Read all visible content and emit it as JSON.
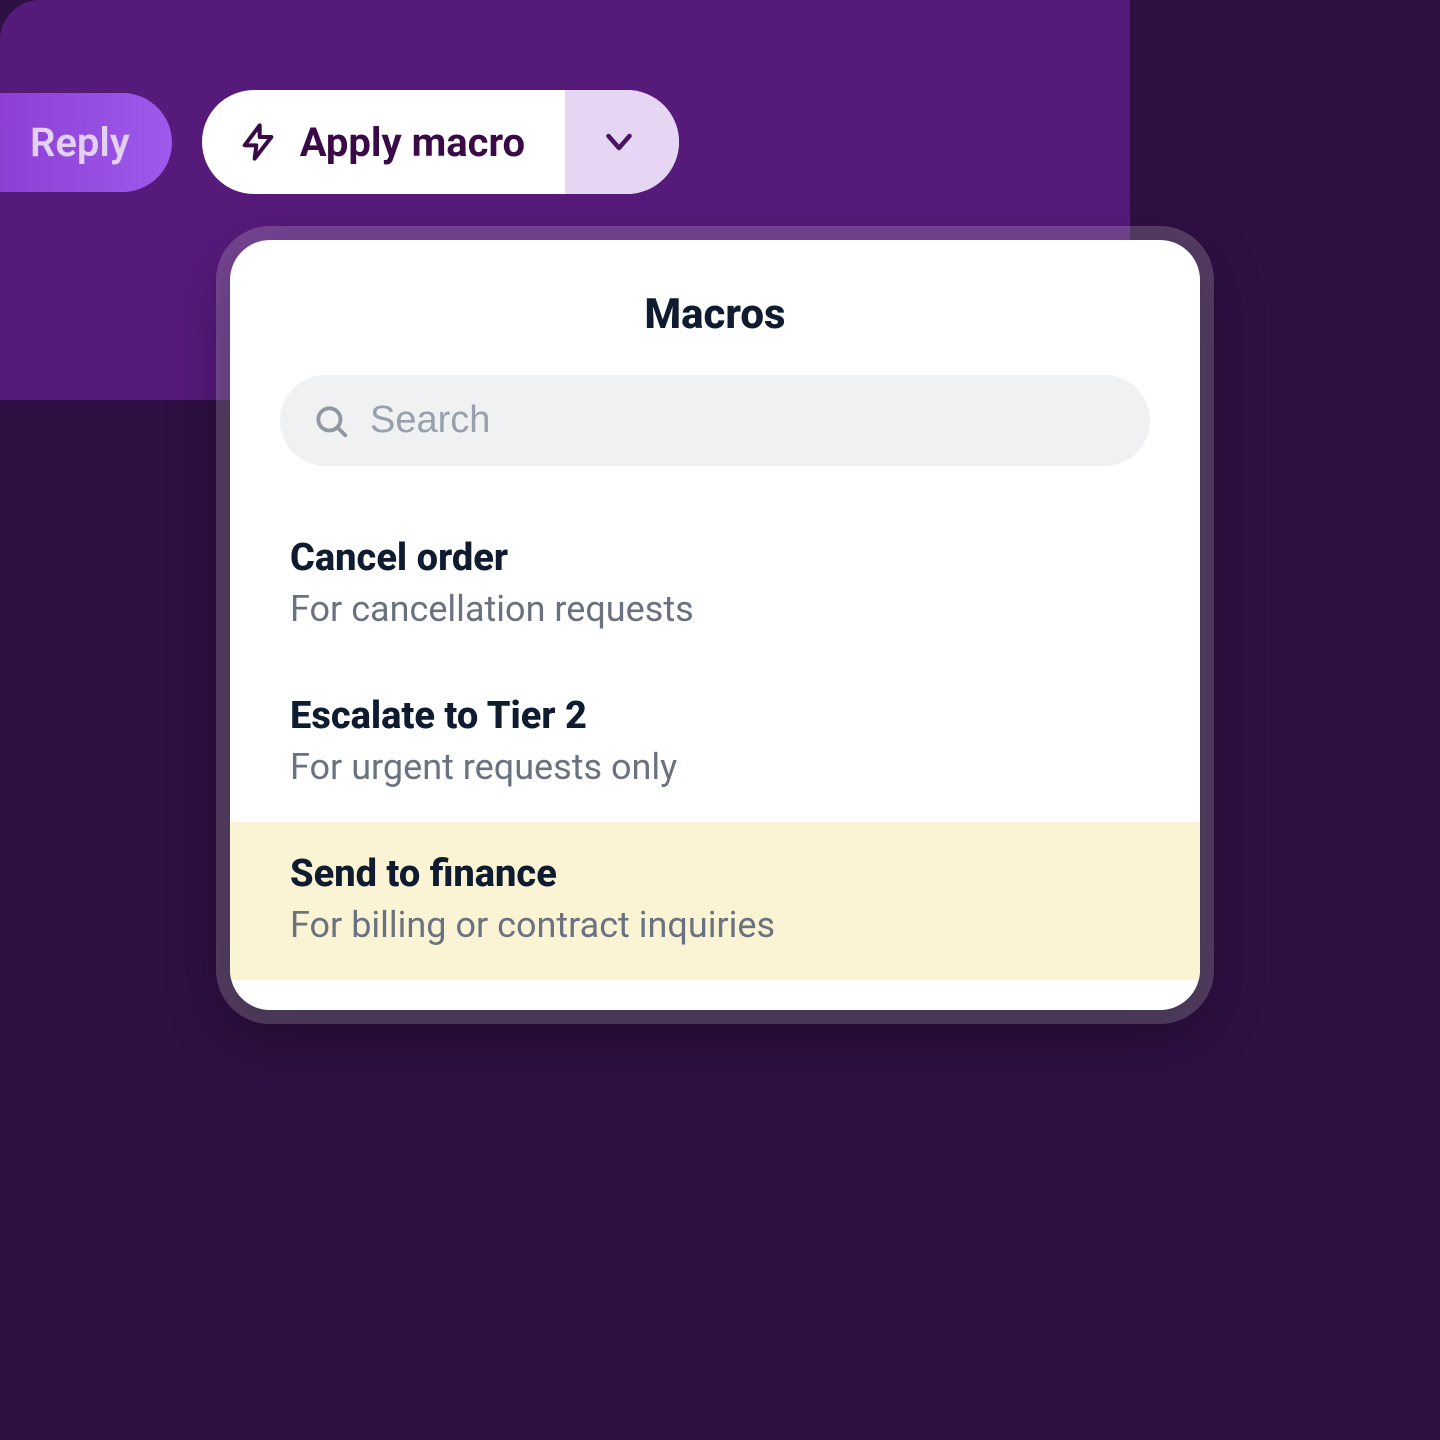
{
  "toolbar": {
    "reply_label": "Reply",
    "apply_macro_label": "Apply macro"
  },
  "dropdown": {
    "title": "Macros",
    "search_placeholder": "Search",
    "items": [
      {
        "name": "Cancel order",
        "desc": "For cancellation requests",
        "highlight": false
      },
      {
        "name": "Escalate to Tier 2",
        "desc": "For urgent requests only",
        "highlight": false
      },
      {
        "name": "Send to finance",
        "desc": "For billing or contract inquiries",
        "highlight": true
      }
    ]
  }
}
